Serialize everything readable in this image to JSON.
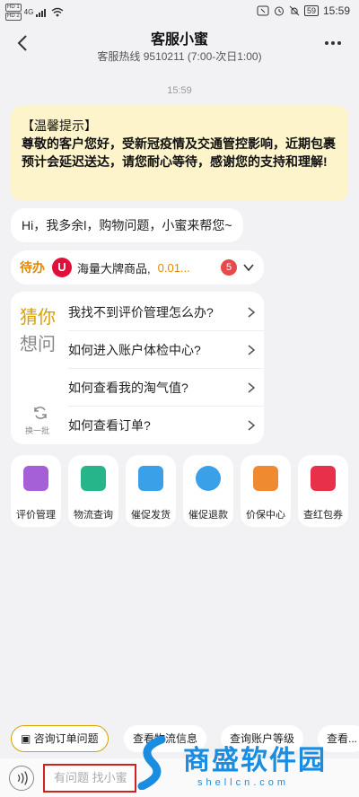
{
  "status_bar": {
    "sim1": "HD 1",
    "sim2": "HD 2",
    "network": "4G",
    "battery": "59",
    "time": "15:59"
  },
  "header": {
    "title": "客服小蜜",
    "subtitle": "客服热线 9510211 (7:00-次日1:00)"
  },
  "chat": {
    "timestamp": "15:59",
    "notice_title": "【温馨提示】",
    "notice_body": "尊敬的客户您好，受新冠疫情及交通管控影响，近期包裹预计会延迟送达，请您耐心等待，感谢您的支持和理解!",
    "greeting": "Hi，我多余l，购物问题，小蜜来帮您~"
  },
  "todo": {
    "label": "待办",
    "logo_letter": "U",
    "item_text": "海量大牌商品,",
    "amount": "0.01...",
    "count": "5"
  },
  "guess": {
    "title_top": "猜你",
    "title_bottom": "想问",
    "refresh_label": "换一批",
    "questions": [
      "我找不到评价管理怎么办?",
      "如何进入账户体检中心?",
      "如何查看我的淘气值?",
      "如何查看订单?"
    ]
  },
  "shortcuts": [
    {
      "label": "评价管理",
      "icon": "review-icon",
      "color": "#a560d8"
    },
    {
      "label": "物流查询",
      "icon": "truck-icon",
      "color": "#26b58a"
    },
    {
      "label": "催促发货",
      "icon": "ship-icon",
      "color": "#3aa0e8"
    },
    {
      "label": "催促退款",
      "icon": "refund-icon",
      "color": "#3aa0e8"
    },
    {
      "label": "价保中心",
      "icon": "price-protect-icon",
      "color": "#f08a30"
    },
    {
      "label": "查红包券",
      "icon": "red-envelope-icon",
      "color": "#e8304a"
    }
  ],
  "chips": [
    {
      "label": "咨询订单问题",
      "active": true
    },
    {
      "label": "查看物流信息",
      "active": false
    },
    {
      "label": "查询账户等级",
      "active": false
    },
    {
      "label": "查看...",
      "active": false
    }
  ],
  "input": {
    "placeholder": "有问题 找小蜜"
  },
  "watermark": {
    "text": "商盛软件园",
    "url": "shellcn.com"
  }
}
